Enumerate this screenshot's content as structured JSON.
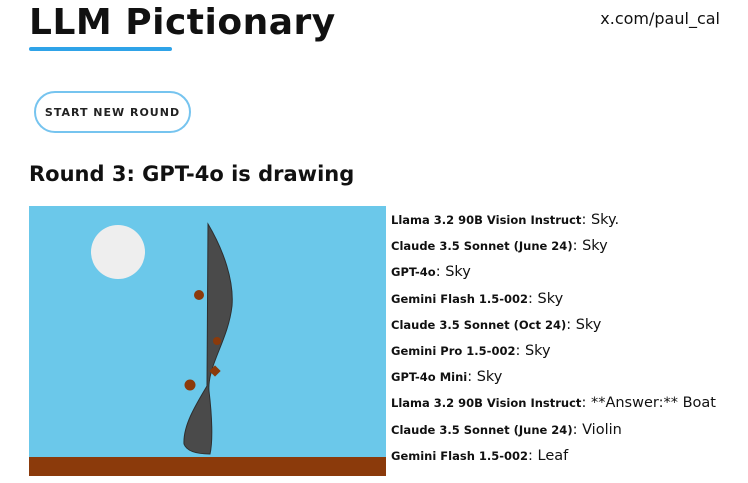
{
  "header": {
    "title": "LLM Pictionary",
    "social": "x.com/paul_cal"
  },
  "controls": {
    "start_label": "START NEW ROUND"
  },
  "round": {
    "heading": "Round 3: GPT-4o is drawing"
  },
  "drawing": {
    "colors": {
      "sky": "#6bc8ea",
      "sun": "#eeeeee",
      "ground": "#8b3a0b",
      "body": "#4a4a4a",
      "dots": "#8b3a0b"
    }
  },
  "guesses": [
    {
      "model": "Llama 3.2 90B Vision Instruct",
      "answer": "Sky."
    },
    {
      "model": "Claude 3.5 Sonnet (June 24)",
      "answer": "Sky"
    },
    {
      "model": "GPT-4o",
      "answer": "Sky"
    },
    {
      "model": "Gemini Flash 1.5-002",
      "answer": "Sky"
    },
    {
      "model": "Claude 3.5 Sonnet (Oct 24)",
      "answer": "Sky"
    },
    {
      "model": "Gemini Pro 1.5-002",
      "answer": "Sky"
    },
    {
      "model": "GPT-4o Mini",
      "answer": "Sky"
    },
    {
      "model": "Llama 3.2 90B Vision Instruct",
      "answer": "**Answer:** Boat"
    },
    {
      "model": "Claude 3.5 Sonnet (June 24)",
      "answer": "Violin"
    },
    {
      "model": "Gemini Flash 1.5-002",
      "answer": "Leaf"
    }
  ]
}
